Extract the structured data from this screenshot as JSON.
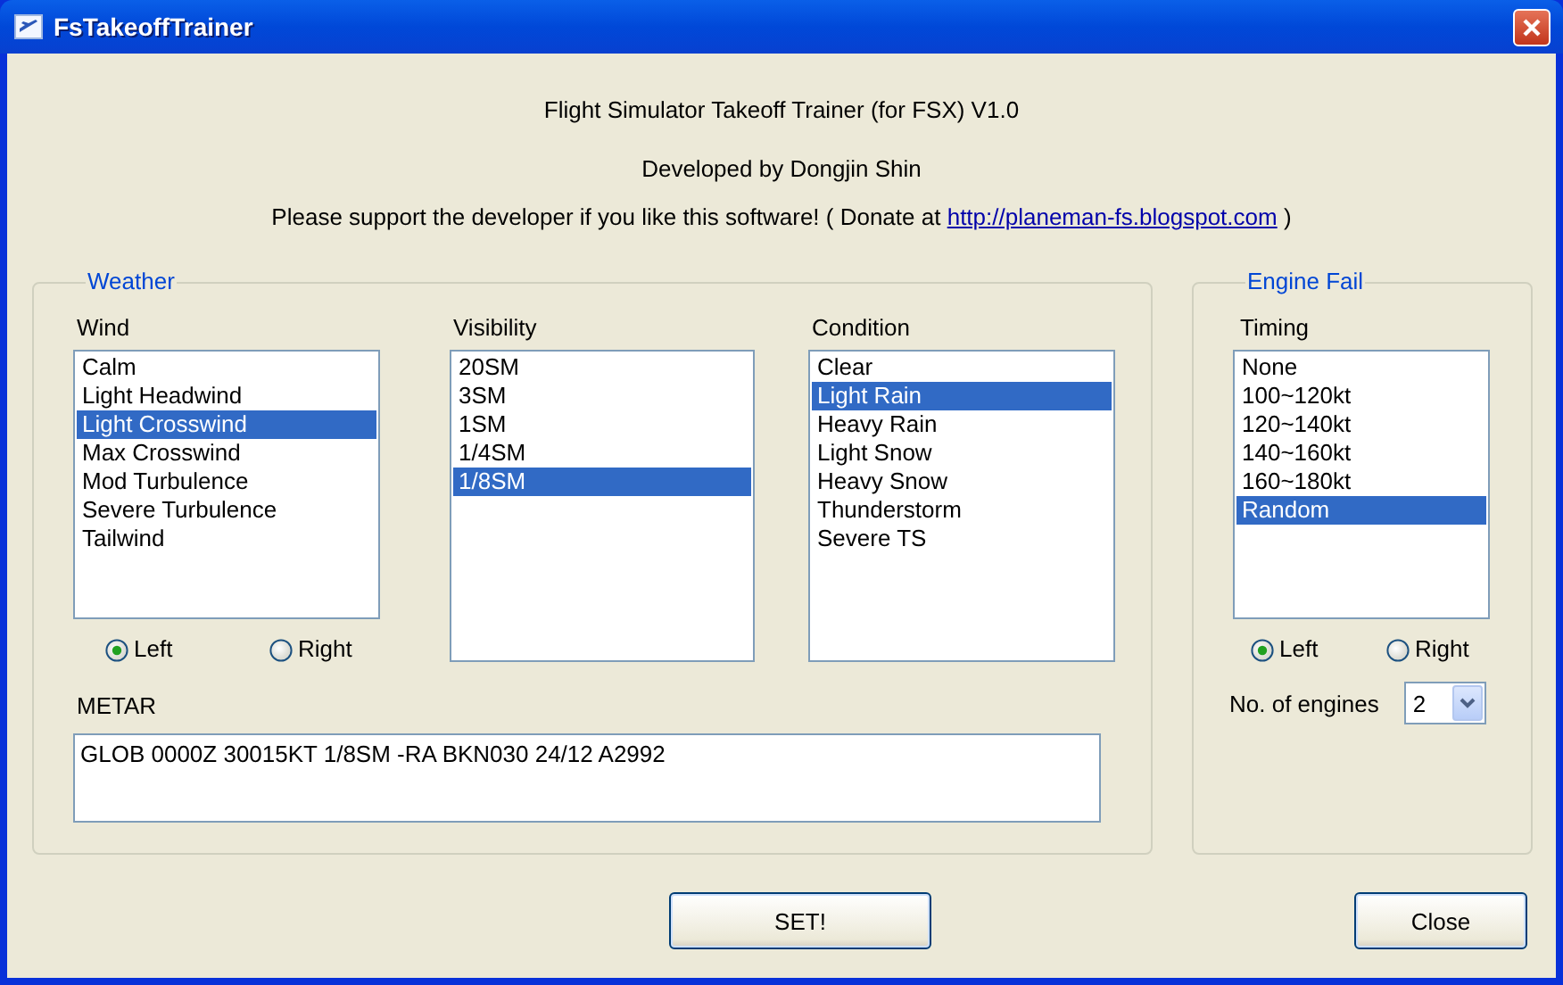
{
  "window": {
    "title": "FsTakeoffTrainer"
  },
  "header": {
    "title_line": "Flight Simulator Takeoff Trainer (for FSX) V1.0",
    "developer_line": "Developed by Dongjin Shin",
    "support_text": "Please support the developer if you like this software!  ( Donate at",
    "link": "http://planeman-fs.blogspot.com",
    "support_end": ")"
  },
  "weather": {
    "title": "Weather",
    "lists": [
      {
        "label": "Wind",
        "items": [
          {
            "text": "Calm",
            "selected": false
          },
          {
            "text": "Light Headwind",
            "selected": false
          },
          {
            "text": "Light Crosswind",
            "selected": true
          },
          {
            "text": "Max Crosswind",
            "selected": false
          },
          {
            "text": "Mod Turbulence",
            "selected": false
          },
          {
            "text": "Severe Turbulence",
            "selected": false
          },
          {
            "text": "Tailwind",
            "selected": false
          }
        ],
        "radios": [
          {
            "label": "Left",
            "selected": true
          },
          {
            "label": "Right",
            "selected": false
          }
        ]
      },
      {
        "label": "Visibility",
        "items": [
          {
            "text": "20SM",
            "selected": false
          },
          {
            "text": "3SM",
            "selected": false
          },
          {
            "text": "1SM",
            "selected": false
          },
          {
            "text": "1/4SM",
            "selected": false
          },
          {
            "text": "1/8SM",
            "selected": true
          }
        ]
      },
      {
        "label": "Condition",
        "items": [
          {
            "text": "Clear",
            "selected": false
          },
          {
            "text": "Light Rain",
            "selected": true
          },
          {
            "text": "Heavy Rain",
            "selected": false
          },
          {
            "text": "Light Snow",
            "selected": false
          },
          {
            "text": "Heavy Snow",
            "selected": false
          },
          {
            "text": "Thunderstorm",
            "selected": false
          },
          {
            "text": "Severe TS",
            "selected": false
          }
        ]
      }
    ],
    "metar": {
      "label": "METAR",
      "value": "GLOB 0000Z 30015KT 1/8SM -RA BKN030 24/12 A2992"
    }
  },
  "engine_fail": {
    "title": "Engine Fail",
    "timing": {
      "label": "Timing",
      "items": [
        {
          "text": "None",
          "selected": false
        },
        {
          "text": "100~120kt",
          "selected": false
        },
        {
          "text": "120~140kt",
          "selected": false
        },
        {
          "text": "140~160kt",
          "selected": false
        },
        {
          "text": "160~180kt",
          "selected": false
        },
        {
          "text": "Random",
          "selected": true
        }
      ]
    },
    "radios": [
      {
        "label": "Left",
        "selected": true
      },
      {
        "label": "Right",
        "selected": false
      }
    ],
    "engines": {
      "label": "No. of engines",
      "value": "2"
    }
  },
  "buttons": [
    {
      "label": "SET!"
    },
    {
      "label": "Close"
    }
  ]
}
